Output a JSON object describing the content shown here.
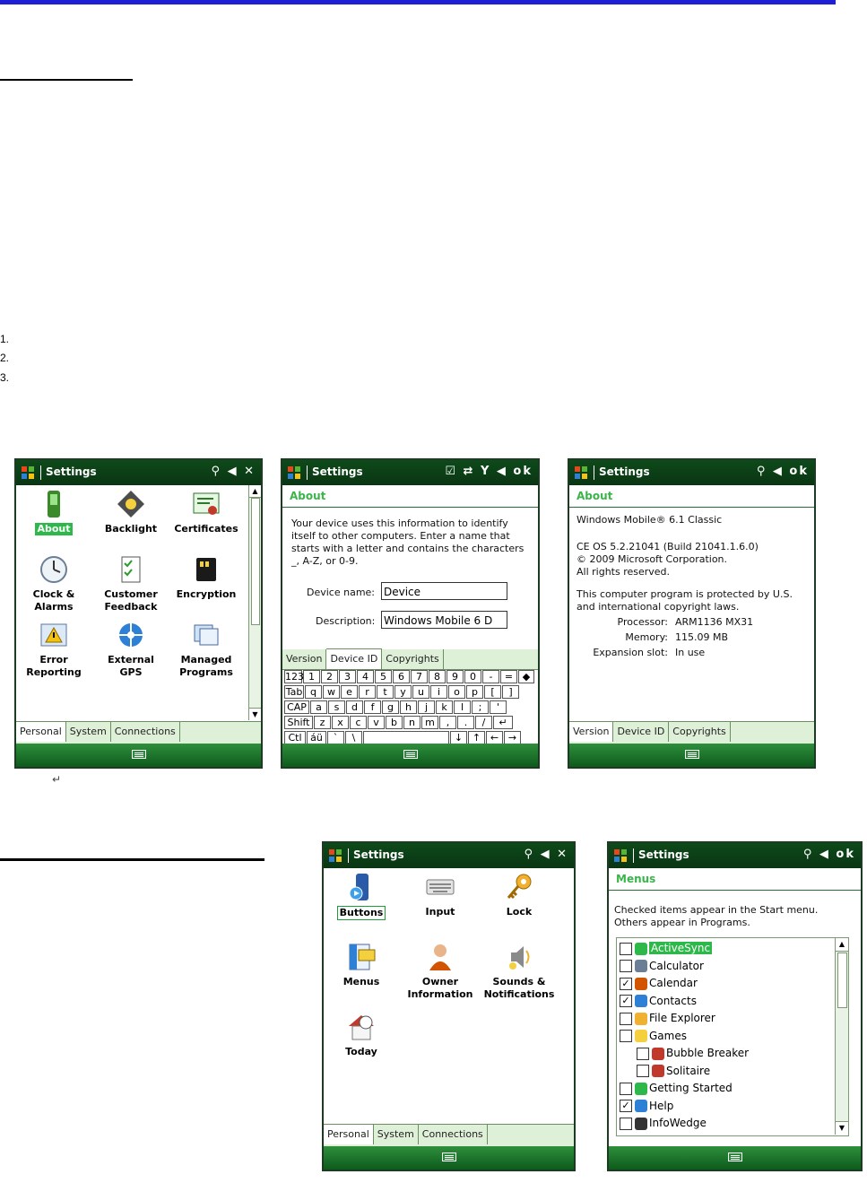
{
  "doc": {
    "numbers": [
      "1.",
      "2.",
      "3."
    ],
    "return_mark": "↵",
    "top_rule_color": "#1f1fd6"
  },
  "screen1": {
    "title": "Settings",
    "status": "⚲ ◀ ✕",
    "items": [
      {
        "label": "About",
        "icon": "about-icon"
      },
      {
        "label": "Backlight",
        "icon": "backlight-icon"
      },
      {
        "label": "Certificates",
        "icon": "certificates-icon"
      },
      {
        "label": "Clock &\nAlarms",
        "icon": "clock-icon"
      },
      {
        "label": "Customer\nFeedback",
        "icon": "feedback-icon"
      },
      {
        "label": "Encryption",
        "icon": "encryption-icon"
      },
      {
        "label": "Error\nReporting",
        "icon": "error-reporting-icon"
      },
      {
        "label": "External\nGPS",
        "icon": "gps-icon"
      },
      {
        "label": "Managed\nPrograms",
        "icon": "managed-programs-icon"
      }
    ],
    "tabs": [
      "Personal",
      "System",
      "Connections"
    ]
  },
  "screen2": {
    "title": "Settings",
    "status": "☑ ⇄ Y ◀ ok",
    "header": "About",
    "intro": "Your device uses this information to identify itself to other computers. Enter a name that starts with a letter and contains the characters _, A-Z, or 0-9.",
    "device_name_label": "Device name:",
    "device_name_value": "Device",
    "description_label": "Description:",
    "description_value": "Windows Mobile 6 D",
    "tabs": [
      "Version",
      "Device ID",
      "Copyrights"
    ],
    "keyboard": [
      [
        "123",
        "1",
        "2",
        "3",
        "4",
        "5",
        "6",
        "7",
        "8",
        "9",
        "0",
        "-",
        "=",
        "◆"
      ],
      [
        "Tab",
        "q",
        "w",
        "e",
        "r",
        "t",
        "y",
        "u",
        "i",
        "o",
        "p",
        "[",
        "]"
      ],
      [
        "CAP",
        "a",
        "s",
        "d",
        "f",
        "g",
        "h",
        "j",
        "k",
        "l",
        ";",
        "'"
      ],
      [
        "Shift",
        "z",
        "x",
        "c",
        "v",
        "b",
        "n",
        "m",
        ",",
        ".",
        "/",
        "↵"
      ],
      [
        "Ctl",
        "áü",
        "`",
        "\\",
        "",
        "↓",
        "↑",
        "←",
        "→"
      ]
    ]
  },
  "screen3": {
    "title": "Settings",
    "status": "⚲ ◀ ok",
    "header": "About",
    "os": "Windows Mobile® 6.1 Classic",
    "ce": "CE OS 5.2.21041 (Build 21041.1.6.0)",
    "copyright": "© 2009 Microsoft Corporation.",
    "rights": "All rights reserved.",
    "protected": "This computer program is protected by U.S. and international copyright laws.",
    "processor_label": "Processor:",
    "processor_value": "ARM1136 MX31",
    "memory_label": "Memory:",
    "memory_value": "115.09 MB",
    "expansion_label": "Expansion slot:",
    "expansion_value": "In use",
    "tabs": [
      "Version",
      "Device ID",
      "Copyrights"
    ]
  },
  "screen4": {
    "title": "Settings",
    "status": "⚲ ◀ ✕",
    "items": [
      {
        "label": "Buttons",
        "icon": "buttons-icon"
      },
      {
        "label": "Input",
        "icon": "keyboard-icon"
      },
      {
        "label": "Lock",
        "icon": "key-icon"
      },
      {
        "label": "Menus",
        "icon": "menus-icon"
      },
      {
        "label": "Owner\nInformation",
        "icon": "owner-icon"
      },
      {
        "label": "Sounds &\nNotifications",
        "icon": "sounds-icon"
      },
      {
        "label": "Today",
        "icon": "today-icon"
      }
    ],
    "tabs": [
      "Personal",
      "System",
      "Connections"
    ]
  },
  "screen5": {
    "title": "Settings",
    "status": "⚲ ◀ ok",
    "header": "Menus",
    "intro": "Checked items appear in the Start menu. Others appear in Programs.",
    "items": [
      {
        "label": "ActiveSync",
        "checked": false,
        "indent": false,
        "selected": true
      },
      {
        "label": "Calculator",
        "checked": false,
        "indent": false
      },
      {
        "label": "Calendar",
        "checked": true,
        "indent": false
      },
      {
        "label": "Contacts",
        "checked": true,
        "indent": false
      },
      {
        "label": "File Explorer",
        "checked": false,
        "indent": false
      },
      {
        "label": "Games",
        "checked": false,
        "indent": false
      },
      {
        "label": "Bubble Breaker",
        "checked": false,
        "indent": true
      },
      {
        "label": "Solitaire",
        "checked": false,
        "indent": true
      },
      {
        "label": "Getting Started",
        "checked": false,
        "indent": false
      },
      {
        "label": "Help",
        "checked": true,
        "indent": false
      },
      {
        "label": "InfoWedge",
        "checked": false,
        "indent": false
      }
    ]
  }
}
